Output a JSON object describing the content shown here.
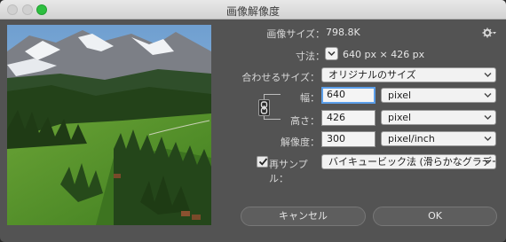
{
  "window": {
    "title": "画像解像度"
  },
  "info": {
    "size_label": "画像サイズ：",
    "size_value": "798.8K",
    "dimensions_label": "寸法：",
    "dimensions_value": "640 px × 426 px"
  },
  "fit": {
    "label": "合わせるサイズ：",
    "value": "オリジナルのサイズ"
  },
  "width": {
    "label": "幅：",
    "value": "640",
    "unit": "pixel"
  },
  "height": {
    "label": "高さ：",
    "value": "426",
    "unit": "pixel"
  },
  "resolution": {
    "label": "解像度：",
    "value": "300",
    "unit": "pixel/inch"
  },
  "resample": {
    "checked": true,
    "label": "再サンプル：",
    "method": "バイキュービック法 (滑らかなグラデーシ..."
  },
  "buttons": {
    "cancel": "キャンセル",
    "ok": "OK"
  },
  "icons": {
    "gear": "gear-icon",
    "link": "chain-link-icon",
    "dropdown": "chevron-down-icon",
    "checkbox": "checkmark-icon"
  }
}
